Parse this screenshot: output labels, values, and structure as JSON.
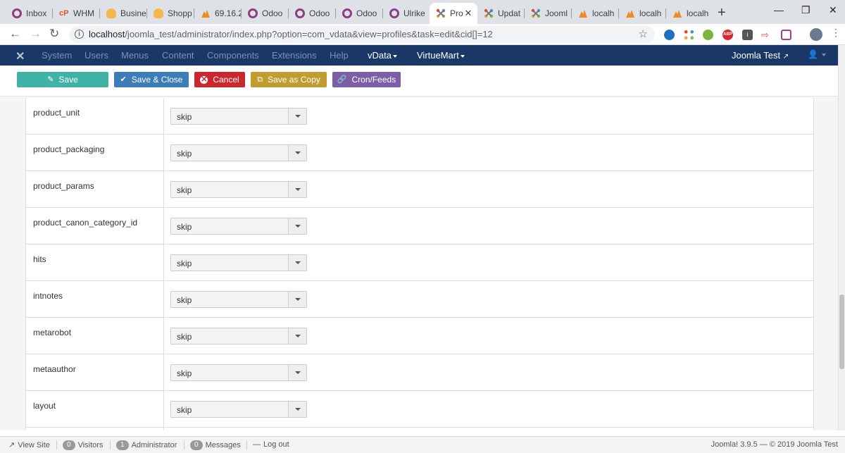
{
  "browser": {
    "tabs": [
      {
        "title": "Inbox",
        "icon": "circle-ring-icon"
      },
      {
        "title": "WHM",
        "icon": "cpanel-icon"
      },
      {
        "title": "Busine",
        "icon": "shopware-icon"
      },
      {
        "title": "Shopp",
        "icon": "shopware-icon"
      },
      {
        "title": "69.16.2",
        "icon": "triangle-logo-icon"
      },
      {
        "title": "Odoo",
        "icon": "circle-ring-icon"
      },
      {
        "title": "Odoo",
        "icon": "circle-ring-icon"
      },
      {
        "title": "Odoo",
        "icon": "circle-ring-icon"
      },
      {
        "title": "Ulrike",
        "icon": "circle-ring-icon"
      },
      {
        "title": "Pro",
        "icon": "joomla-icon",
        "active": true
      },
      {
        "title": "Updat",
        "icon": "joomla-icon"
      },
      {
        "title": "Jooml",
        "icon": "joomla-icon"
      },
      {
        "title": "localh",
        "icon": "triangle-logo-icon"
      },
      {
        "title": "localh",
        "icon": "triangle-logo-icon"
      },
      {
        "title": "localh",
        "icon": "triangle-logo-icon"
      }
    ],
    "url_host": "localhost",
    "url_path": "/joomla_test/administrator/index.php?option=com_vdata&view=profiles&task=edit&cid[]=12"
  },
  "admin_nav": {
    "items": [
      "System",
      "Users",
      "Menus",
      "Content",
      "Components",
      "Extensions",
      "Help"
    ],
    "vdata": "vData",
    "virtuemart": "VirtueMart",
    "site": "Joomla Test"
  },
  "toolbar": {
    "save": "Save",
    "save_close": "Save & Close",
    "cancel": "Cancel",
    "save_copy": "Save as Copy",
    "cron": "Cron/Feeds"
  },
  "fields": [
    {
      "name": "product_unit",
      "value": "skip"
    },
    {
      "name": "product_packaging",
      "value": "skip"
    },
    {
      "name": "product_params",
      "value": "skip"
    },
    {
      "name": "product_canon_category_id",
      "value": "skip"
    },
    {
      "name": "hits",
      "value": "skip"
    },
    {
      "name": "intnotes",
      "value": "skip"
    },
    {
      "name": "metarobot",
      "value": "skip"
    },
    {
      "name": "metaauthor",
      "value": "skip"
    },
    {
      "name": "layout",
      "value": "skip"
    }
  ],
  "status": {
    "view_site": "View Site",
    "visitors_count": "0",
    "visitors": "Visitors",
    "admin_count": "1",
    "admin": "Administrator",
    "messages_count": "0",
    "messages": "Messages",
    "logout": "Log out",
    "version": "Joomla! 3.9.5 — © 2019 Joomla Test"
  },
  "colors": {
    "navbar": "#1a3867",
    "save": "#3fb3a6",
    "save_close": "#3c7db8",
    "cancel": "#c8282e",
    "save_copy": "#c19c31",
    "cron": "#7b5ea7"
  }
}
